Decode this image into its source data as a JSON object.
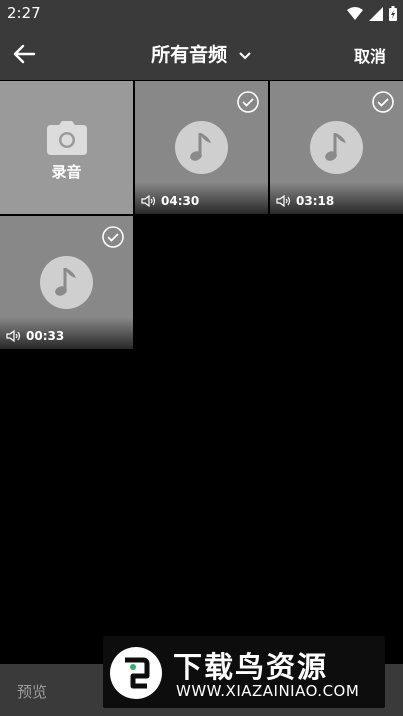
{
  "status_bar": {
    "time": "2:27"
  },
  "app_bar": {
    "title": "所有音频",
    "cancel_label": "取消"
  },
  "record_tile": {
    "label": "录音"
  },
  "audio_items": [
    {
      "duration": "04:30",
      "checked": true
    },
    {
      "duration": "03:18",
      "checked": true
    },
    {
      "duration": "00:33",
      "checked": true
    }
  ],
  "bottom_bar": {
    "preview_label": "预览"
  },
  "watermark": {
    "name": "下载鸟资源",
    "url": "WWW.XIAZAINIAO.COM"
  },
  "colors": {
    "bar": "#3a3a3a",
    "tile": "#888888",
    "background": "#000000"
  }
}
